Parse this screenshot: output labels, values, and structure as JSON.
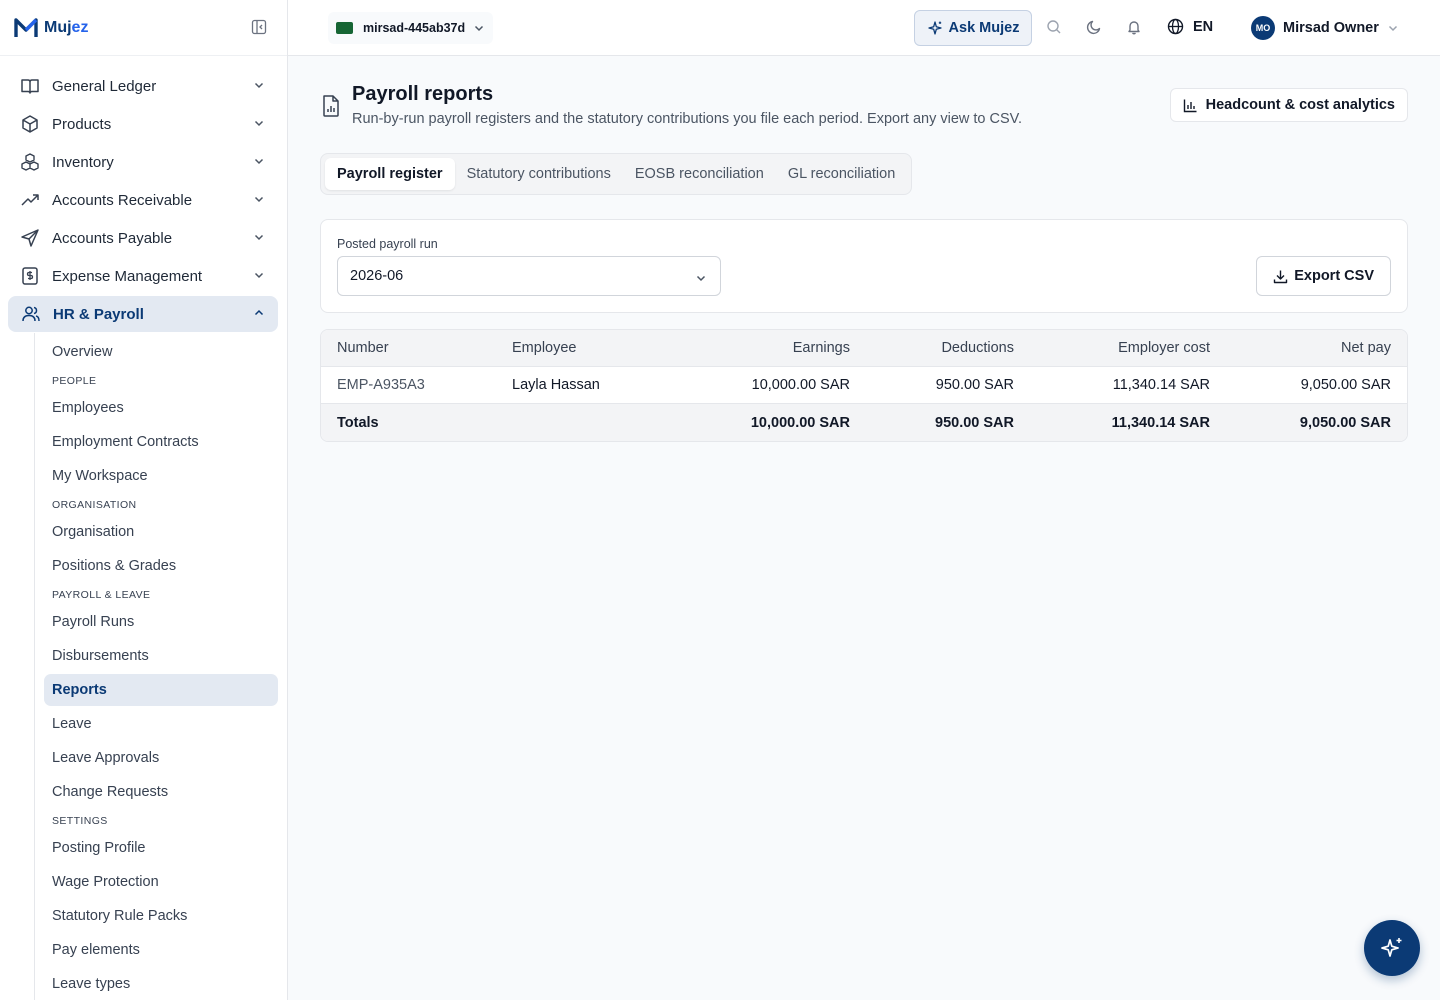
{
  "brand": {
    "name_a": "Muj",
    "name_b": "ez"
  },
  "nav": [
    {
      "label": "General Ledger",
      "icon": "book-icon"
    },
    {
      "label": "Products",
      "icon": "box-icon"
    },
    {
      "label": "Inventory",
      "icon": "boxes-icon"
    },
    {
      "label": "Accounts Receivable",
      "icon": "trend-up-icon"
    },
    {
      "label": "Accounts Payable",
      "icon": "send-icon"
    },
    {
      "label": "Expense Management",
      "icon": "receipt-icon"
    },
    {
      "label": "HR & Payroll",
      "icon": "users-icon"
    }
  ],
  "sub": {
    "overview": "Overview",
    "people_head": "PEOPLE",
    "employees": "Employees",
    "contracts": "Employment Contracts",
    "workspace": "My Workspace",
    "org_head": "ORGANISATION",
    "organisation": "Organisation",
    "positions": "Positions & Grades",
    "payroll_head": "PAYROLL & LEAVE",
    "payroll_runs": "Payroll Runs",
    "disbursements": "Disbursements",
    "reports": "Reports",
    "leave": "Leave",
    "leave_approvals": "Leave Approvals",
    "change_requests": "Change Requests",
    "settings_head": "SETTINGS",
    "posting_profile": "Posting Profile",
    "wage_protection": "Wage Protection",
    "rule_packs": "Statutory Rule Packs",
    "pay_elements": "Pay elements",
    "leave_types": "Leave types"
  },
  "topbar": {
    "tenant": "mirsad-445ab37d",
    "ask": "Ask Mujez",
    "lang": "EN",
    "avatar_initials": "MO",
    "user": "Mirsad Owner"
  },
  "page": {
    "title": "Payroll reports",
    "subtitle": "Run-by-run payroll registers and the statutory contributions you file each period. Export any view to CSV.",
    "analytics": "Headcount & cost analytics"
  },
  "tabs": [
    "Payroll register",
    "Statutory contributions",
    "EOSB reconciliation",
    "GL reconciliation"
  ],
  "filter": {
    "label": "Posted payroll run",
    "value": "2026-06",
    "export": "Export CSV"
  },
  "table": {
    "headers": [
      "Number",
      "Employee",
      "Earnings",
      "Deductions",
      "Employer cost",
      "Net pay"
    ],
    "rows": [
      [
        "EMP-A935A3",
        "Layla Hassan",
        "10,000.00 SAR",
        "950.00 SAR",
        "11,340.14 SAR",
        "9,050.00 SAR"
      ]
    ],
    "totals": [
      "Totals",
      "",
      "10,000.00 SAR",
      "950.00 SAR",
      "11,340.14 SAR",
      "9,050.00 SAR"
    ]
  },
  "colors": {
    "primary": "#0b3a75",
    "accent": "#2563eb",
    "active_bg": "#e3e9f2"
  }
}
